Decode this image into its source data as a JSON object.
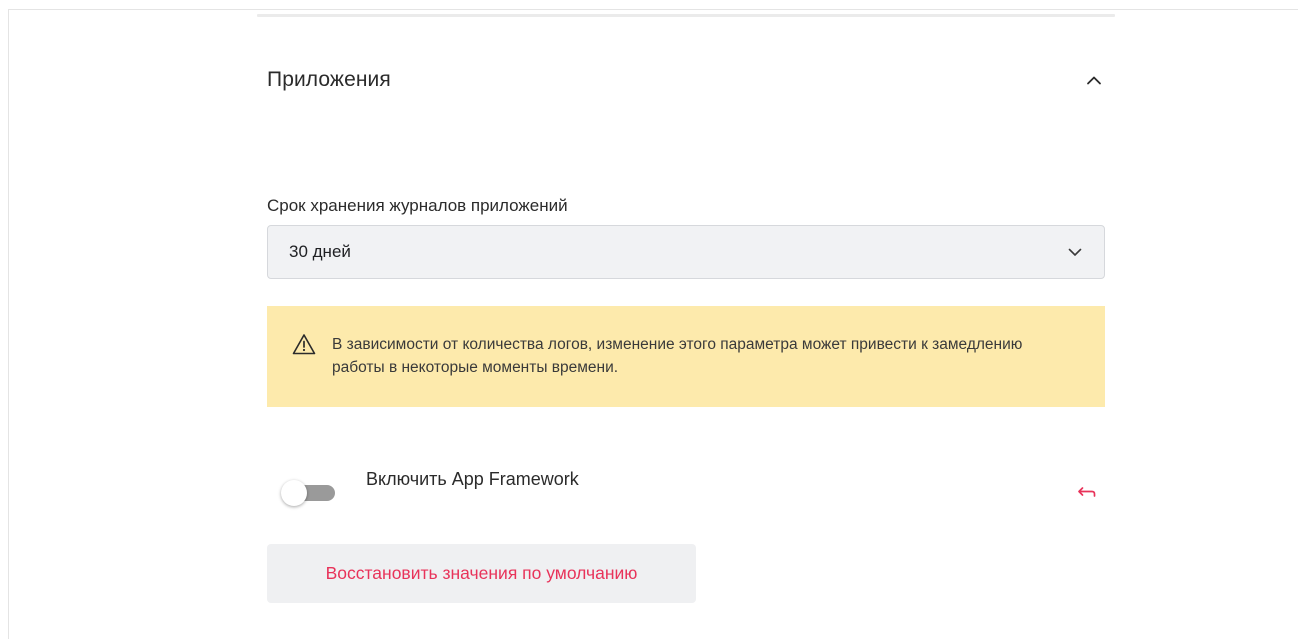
{
  "section": {
    "title": "Приложения",
    "collapse_icon": "chevron-up-icon"
  },
  "log_retention": {
    "label": "Срок хранения журналов приложений",
    "selected_value": "30 дней",
    "dropdown_icon": "chevron-down-icon"
  },
  "warning": {
    "icon": "warning-triangle-icon",
    "text": "В зависимости от количества логов, изменение этого параметра может привести к замедлению работы в некоторые моменты времени.",
    "background_color": "#fdeaac"
  },
  "app_framework": {
    "label": "Включить App Framework",
    "enabled": false,
    "reset_icon": "undo-arrow-icon",
    "reset_icon_color": "#e8335a"
  },
  "restore_button": {
    "label": "Восстановить значения по умолчанию",
    "text_color": "#e8335a"
  }
}
